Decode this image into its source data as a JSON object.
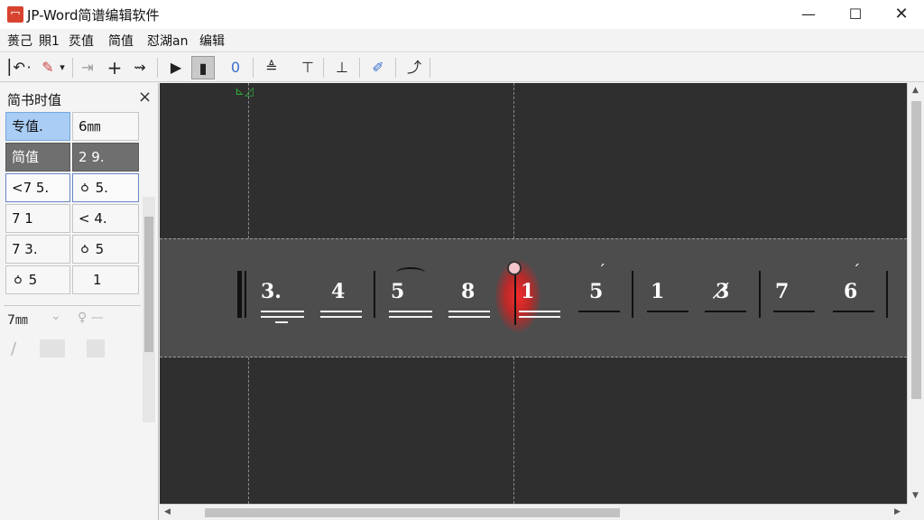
{
  "window": {
    "title": "JP-Word简谱编辑软件",
    "app_icon_glyph": "冖",
    "controls": {
      "minimize": "—",
      "maximize": "☐",
      "close": "✕"
    }
  },
  "menubar": {
    "items": [
      {
        "label": "蒉己"
      },
      {
        "label": "賏1"
      },
      {
        "label": "烎值"
      },
      {
        "label": "简值"
      },
      {
        "label": "怼湖an"
      },
      {
        "label": "编辑"
      }
    ]
  },
  "toolbar": {
    "icons": [
      {
        "name": "undo-icon",
        "glyph": "⎮↶"
      },
      {
        "name": "dot-icon",
        "glyph": "·"
      },
      {
        "name": "paint-icon",
        "glyph": "✎"
      },
      {
        "name": "dropdown-icon",
        "glyph": "▾"
      },
      {
        "name": "redo-icon",
        "glyph": "⇥"
      },
      {
        "name": "plus-icon",
        "glyph": "+"
      },
      {
        "name": "arrow-icon",
        "glyph": "⇝"
      },
      {
        "name": "play-icon",
        "glyph": "▶"
      },
      {
        "name": "stop-icon",
        "glyph": "▮"
      },
      {
        "name": "zero-icon",
        "glyph": "0"
      },
      {
        "name": "align-up-icon",
        "glyph": "≜"
      },
      {
        "name": "align-top-icon",
        "glyph": "⊤"
      },
      {
        "name": "align-bottom-icon",
        "glyph": "⊥"
      },
      {
        "name": "pen-icon",
        "glyph": "✐"
      },
      {
        "name": "curve-icon",
        "glyph": "⤴"
      }
    ]
  },
  "panel": {
    "title": "简书时值",
    "close": "×",
    "grid": [
      [
        "专值.",
        "6㎜"
      ],
      [
        "简值",
        "2 9."
      ],
      [
        "<7 5.",
        "ㆁ 5."
      ],
      [
        "7 1",
        "< 4."
      ],
      [
        "7 3.",
        "ㆁ 5"
      ],
      [
        "ㆁ 5",
        "1"
      ]
    ],
    "controls": {
      "field": "7㎜",
      "chevron": "⌄",
      "key": "♀ —",
      "slash": "/"
    }
  },
  "score": {
    "corner_mark": "⊾◿",
    "notes": [
      {
        "text": "3."
      },
      {
        "text": "4"
      },
      {
        "text": "5"
      },
      {
        "text": "8"
      },
      {
        "text": "1"
      },
      {
        "text": "5"
      },
      {
        "text": "1"
      },
      {
        "text": "3̸"
      },
      {
        "text": "7"
      },
      {
        "text": "6"
      }
    ],
    "accents": [
      "ˊ",
      "ˊ"
    ],
    "colors": {
      "background": "#2f2f2f",
      "band": "#4d4d4d",
      "highlight": "#e02a2a"
    }
  }
}
